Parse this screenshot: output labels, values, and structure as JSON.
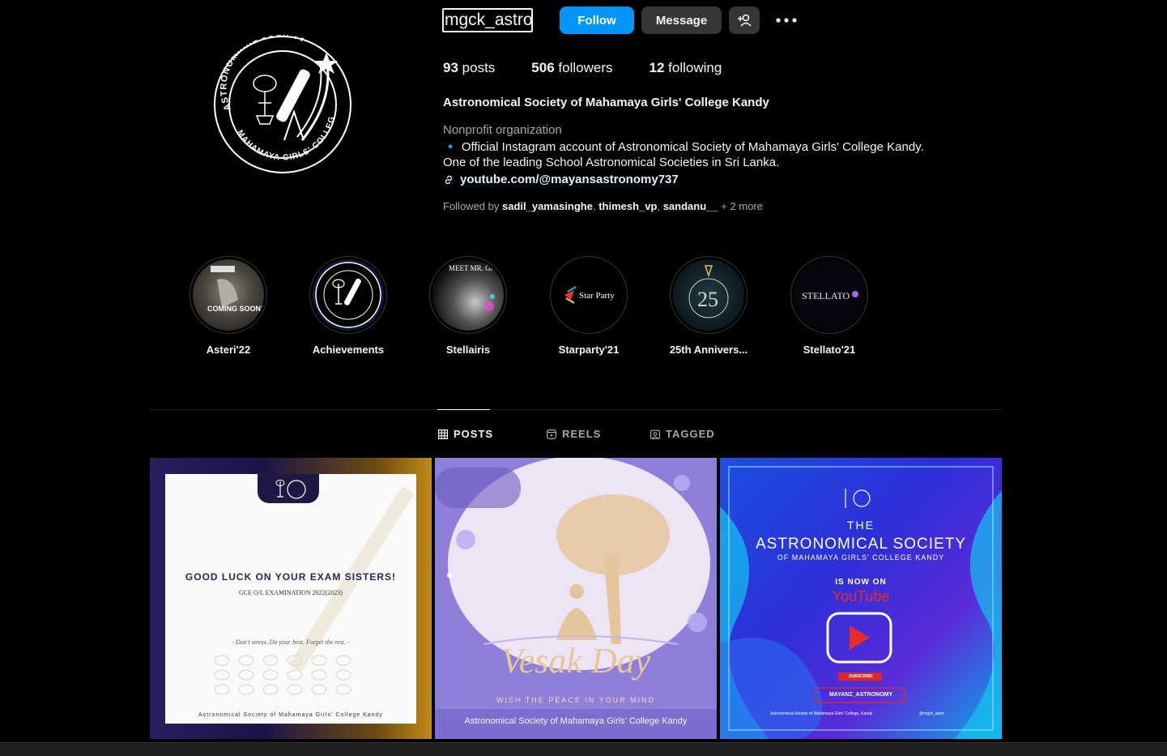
{
  "profile": {
    "username": "mgck_astro",
    "follow_label": "Follow",
    "message_label": "Message",
    "stats": {
      "posts_count": "93",
      "posts_label": "posts",
      "followers_count": "506",
      "followers_label": "followers",
      "following_count": "12",
      "following_label": "following"
    },
    "full_name": "Astronomical Society of Mahamaya Girls' College Kandy",
    "category": "Nonprofit organization",
    "bio_line1": "🔹 Official Instagram account of Astronomical Society of Mahamaya Girls' College Kandy.",
    "bio_line2": "One of the leading School Astronomical Societies in Sri Lanka.",
    "link": "youtube.com/@mayansastronomy737",
    "followed_by_prefix": "Followed by ",
    "followed_by_users": [
      "sadil_yamasinghe",
      "thimesh_vp",
      "sandanu__"
    ],
    "followed_by_sep": ", ",
    "followed_by_more": " + 2 more",
    "avatar_text_top": "ASTRONOMICAL SOCIETY",
    "avatar_text_bottom": "MAHAMAYA GIRLS' COLLEGE"
  },
  "highlights": [
    {
      "label": "Asteri'22",
      "art_text": "COMING SOON!"
    },
    {
      "label": "Achievements",
      "art_text": ""
    },
    {
      "label": "Stellairis",
      "art_text": "MEET MR. GAME"
    },
    {
      "label": "Starparty'21",
      "art_text": "Star Party"
    },
    {
      "label": "25th Annivers...",
      "art_text": "25"
    },
    {
      "label": "Stellato'21",
      "art_text": "STELLATO"
    }
  ],
  "tabs": [
    {
      "label": "POSTS",
      "icon": "grid-icon",
      "active": true
    },
    {
      "label": "REELS",
      "icon": "reels-icon",
      "active": false
    },
    {
      "label": "TAGGED",
      "icon": "tagged-icon",
      "active": false
    }
  ],
  "posts": [
    {
      "headline": "GOOD LUCK ON YOUR EXAM SISTERS!",
      "sub": "GCE O/L EXAMINATION 2022(2023)",
      "quote": "- Don't stress. Do your best. Forget the rest. -",
      "footer": "Astronomical Society of Mahamaya Girls' College Kandy"
    },
    {
      "headline": "Vesak Day",
      "sub": "WISH THE PEACE IN YOUR MIND",
      "footer": "Astronomical Society of Mahamaya Girls' College Kandy"
    },
    {
      "line1": "THE",
      "line2": "ASTRONOMICAL SOCIETY",
      "line3": "OF MAHAMAYA GIRLS' COLLEGE KANDY",
      "line4": "IS NOW ON",
      "line5": "YouTube",
      "subscribe": "SUBSCRIBE",
      "channel": "MAYANZ_ASTRONOMY",
      "footer": "Astronomical Society of Mahamaya Girls' College, Kandy",
      "handle": "@mgck_astro"
    }
  ],
  "colors": {
    "follow_button": "#0095f6",
    "secondary_button": "#363636",
    "background": "#000000"
  }
}
